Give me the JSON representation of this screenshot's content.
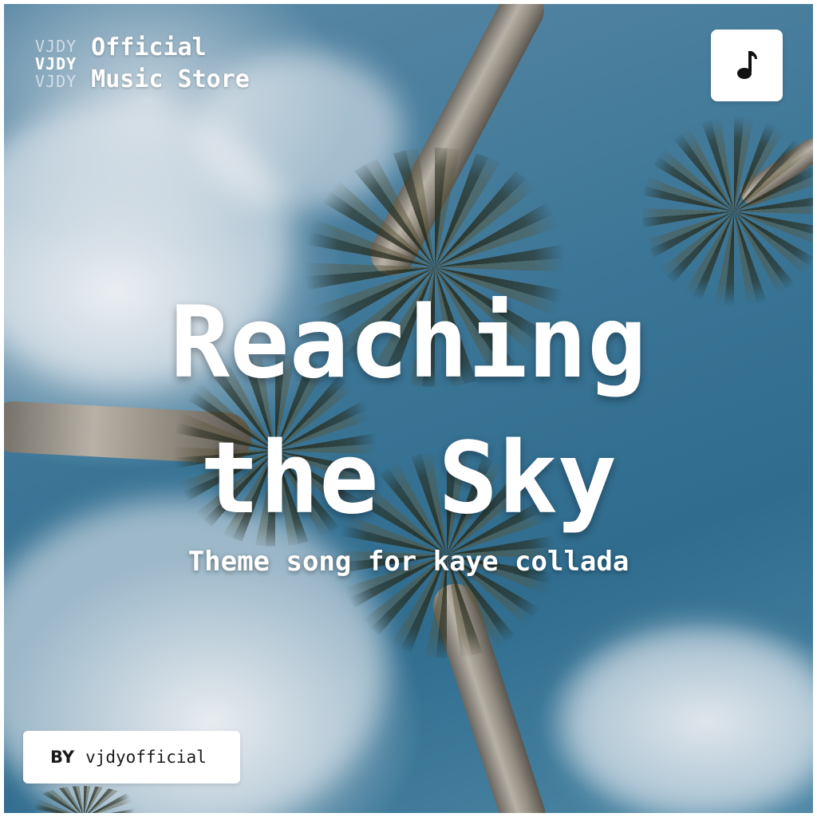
{
  "brand": {
    "stack": [
      "VJDY",
      "VJDY",
      "VJDY"
    ],
    "name_line1": "Official",
    "name_line2": "Music Store"
  },
  "header": {
    "music_icon": "music-note-icon"
  },
  "cover": {
    "title_line1": "Reaching",
    "title_line2": "the Sky",
    "subtitle": "Theme song for kaye collada",
    "background": "palm-trees-sky-photo"
  },
  "credit": {
    "by_label": "BY",
    "artist": "vjdyofficial"
  },
  "colors": {
    "sky": "#3b7596",
    "text": "#ffffff",
    "badge_bg": "#ffffff",
    "badge_text": "#1a1a1a"
  }
}
